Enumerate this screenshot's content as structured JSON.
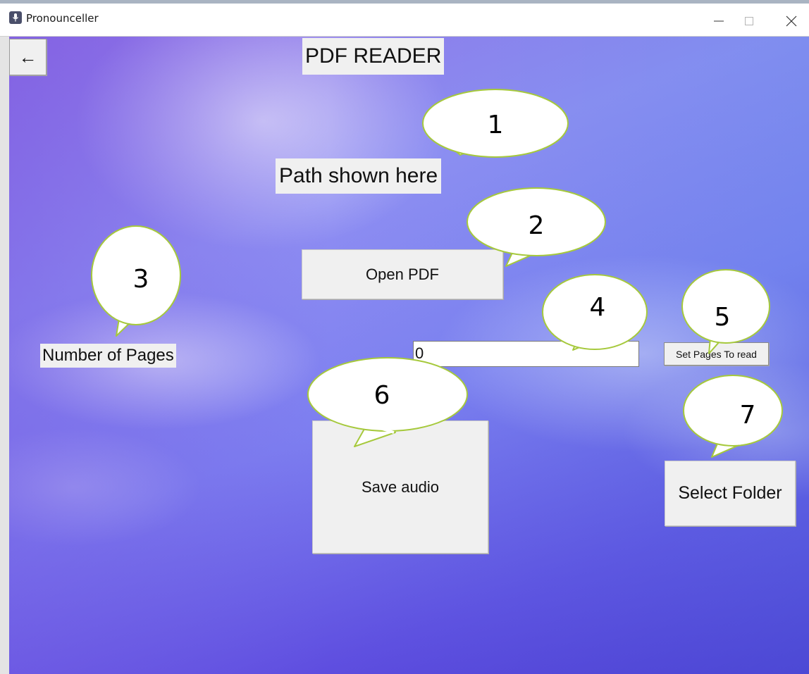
{
  "window": {
    "title": "Pronounceller"
  },
  "icons": {
    "app": "microphone-app-icon",
    "minimize": "minimize-icon",
    "maximize": "maximize-icon",
    "close": "close-icon",
    "back": "back-arrow-icon"
  },
  "main": {
    "back_label": "←",
    "title": "PDF READER",
    "path_label": "Path shown here",
    "open_pdf_label": "Open PDF",
    "pages_label": "Number of Pages",
    "pages_input_value": "0",
    "set_pages_label": "Set Pages To read",
    "save_audio_label": "Save audio",
    "select_folder_label": "Select Folder"
  },
  "callouts": [
    {
      "number": "1"
    },
    {
      "number": "2"
    },
    {
      "number": "3"
    },
    {
      "number": "4"
    },
    {
      "number": "5"
    },
    {
      "number": "6"
    },
    {
      "number": "7"
    }
  ],
  "colors": {
    "callout_fill": "#ffffff",
    "callout_stroke": "#a6c93c",
    "widget_bg": "#f0f0f0",
    "background_purple": "#7d7ff0"
  }
}
